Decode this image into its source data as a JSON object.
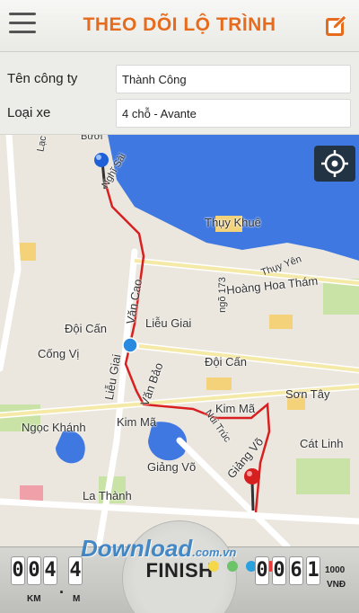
{
  "header": {
    "title": "THEO DÕI LỘ TRÌNH",
    "menu_icon": "hamburger-menu-icon",
    "edit_icon": "edit-icon",
    "accent": "#e76b1d"
  },
  "form": {
    "company_label": "Tên công ty",
    "company_value": "Thành Công",
    "vehicle_label": "Loại xe",
    "vehicle_value": "4 chỗ - Avante"
  },
  "map": {
    "locate_icon": "crosshair-locate-icon",
    "start_marker_icon": "blue-pin-icon",
    "end_marker_icon": "red-pin-icon",
    "current_position_icon": "blue-dot-icon",
    "route_color": "#d82020",
    "labels": {
      "thuy_khue": "Thụy Khuê",
      "hoang_hoa_tham": "Hoàng Hoa Thám",
      "doi_can": "Đội Cấn",
      "doi_can_2": "Đội Cấn",
      "lieu_giai": "Liễu Giai",
      "lieu_giai_street": "Liễu Giai",
      "van_cao": "Văn Cao",
      "van_bao": "Văn Bảo",
      "cong_vi": "Cống Vị",
      "kim_ma": "Kim Mã",
      "kim_ma_2": "Kim Mã",
      "son_tay": "Sơn Tây",
      "ngoc_khanh": "Ngọc Khánh",
      "giang_vo": "Giảng Võ",
      "giang_vo_2": "Giảng Võ",
      "nui_truc": "Núi Trúc",
      "cat_linh": "Cát Linh",
      "la_thanh": "La Thành",
      "ngo_173": "ngõ 173",
      "thuy_yen": "Thụy Yên",
      "lac": "Lạc",
      "buoi": "Bưởi",
      "nghi_sai": "Nghĩ Sài"
    }
  },
  "bottom": {
    "km_digits": [
      "0",
      "0",
      "4",
      "4"
    ],
    "km_unit": "KM",
    "m_unit": "M",
    "finish_label": "FINISH",
    "fare_digits": [
      "0",
      "0",
      "6",
      "1"
    ],
    "fare_unit_top": "1000",
    "fare_unit_bottom": "VNĐ",
    "watermark_main": "Download",
    "watermark_suffix": ".com.vn"
  }
}
